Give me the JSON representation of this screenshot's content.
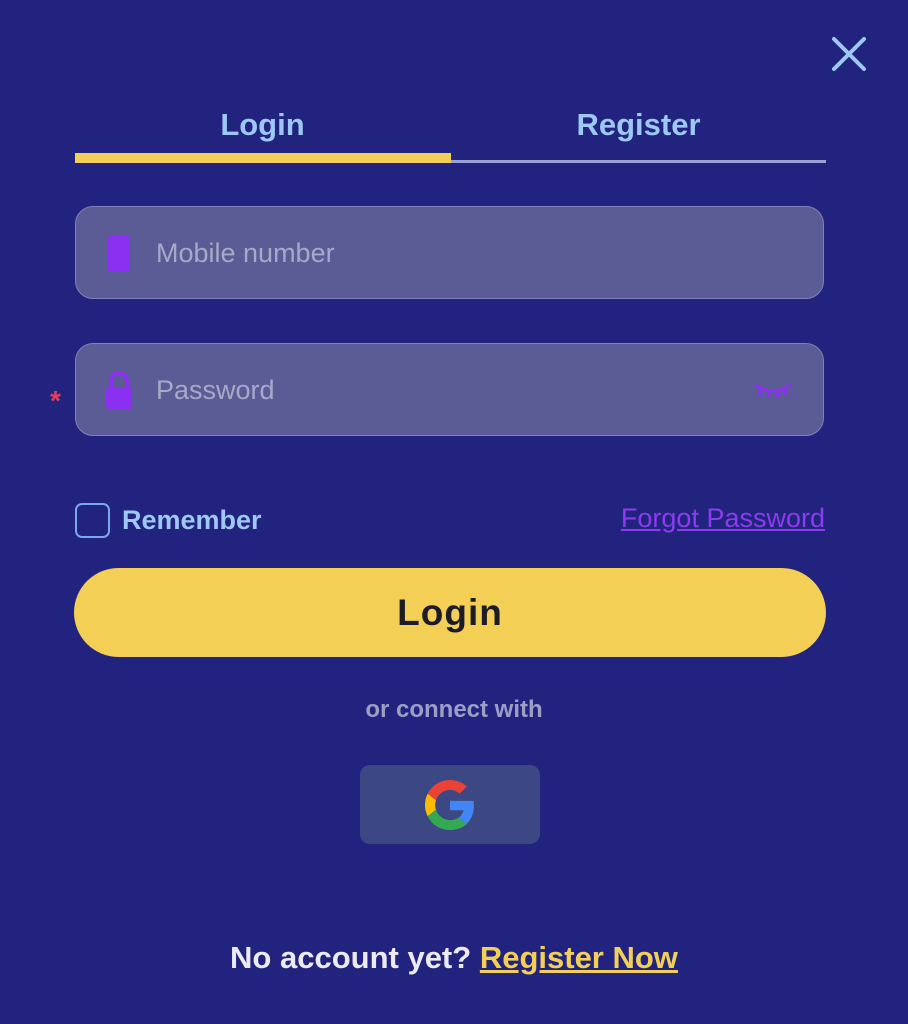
{
  "tabs": [
    {
      "label": "Login",
      "active": true
    },
    {
      "label": "Register",
      "active": false
    }
  ],
  "form": {
    "mobile": {
      "placeholder": "Mobile number",
      "value": "",
      "icon": "phone-icon"
    },
    "password": {
      "placeholder": "Password",
      "value": "",
      "icon": "lock-icon",
      "required_mark": "*"
    },
    "remember_label": "Remember",
    "forgot_label": "Forgot Password",
    "submit_label": "Login"
  },
  "social": {
    "divider_text": "or connect with",
    "providers": [
      {
        "name": "google",
        "icon": "google-icon"
      }
    ]
  },
  "footer": {
    "prompt": "No account yet?",
    "link": "Register Now"
  },
  "colors": {
    "background": "#22237f",
    "accent": "#f3cf55",
    "tab_text": "#9dc8f4",
    "link_purple": "#8c3bef",
    "icon_purple": "#8b2ff0",
    "required": "#e0405a"
  }
}
